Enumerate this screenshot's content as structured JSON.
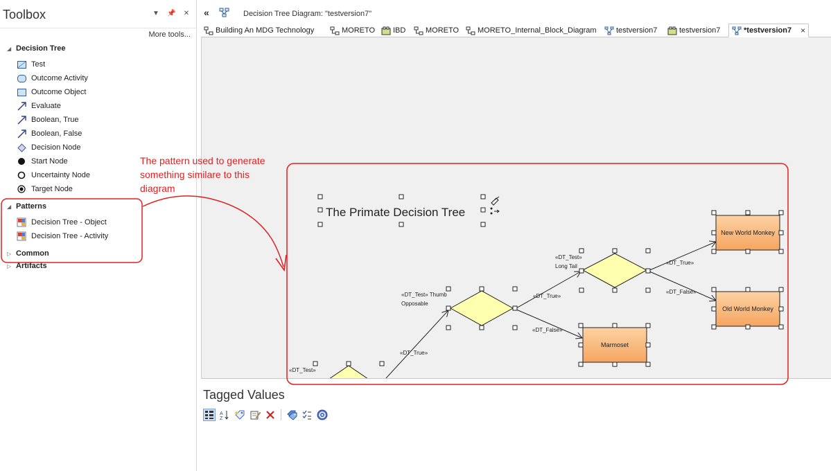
{
  "toolbox": {
    "title": "Toolbox",
    "more_tools": "More tools...",
    "groups": [
      {
        "label": "Decision Tree",
        "items": [
          {
            "label": "Test",
            "icon": "class-box-icon"
          },
          {
            "label": "Outcome Activity",
            "icon": "rounded-box-icon"
          },
          {
            "label": "Outcome Object",
            "icon": "class-box-icon"
          },
          {
            "label": "Evaluate",
            "icon": "arrow-icon"
          },
          {
            "label": "Boolean, True",
            "icon": "arrow-icon"
          },
          {
            "label": "Boolean, False",
            "icon": "arrow-icon"
          },
          {
            "label": "Decision Node",
            "icon": "diamond-icon"
          },
          {
            "label": "Start Node",
            "icon": "filled-circle-icon"
          },
          {
            "label": "Uncertainty Node",
            "icon": "hollow-circle-icon"
          },
          {
            "label": "Target Node",
            "icon": "target-circle-icon"
          }
        ]
      },
      {
        "label": "Patterns",
        "items": [
          {
            "label": "Decision Tree - Object",
            "icon": "pattern-icon"
          },
          {
            "label": "Decision Tree - Activity",
            "icon": "pattern-icon"
          }
        ]
      },
      {
        "label": "Common",
        "items": []
      },
      {
        "label": "Artifacts",
        "items": []
      }
    ]
  },
  "diagram_window": {
    "title": "Decision Tree Diagram: \"testversion7\"",
    "tabs": [
      {
        "label": "Building An MDG Technology",
        "icon": "diagram-icon"
      },
      {
        "label": "MORETO",
        "icon": "diagram-icon"
      },
      {
        "label": "IBD",
        "icon": "ibd-icon"
      },
      {
        "label": "MORETO",
        "icon": "diagram-icon"
      },
      {
        "label": "MORETO_Internal_Block_Diagram",
        "icon": "diagram-icon"
      },
      {
        "label": "testversion7",
        "icon": "decision-tree-icon"
      },
      {
        "label": "testversion7",
        "icon": "ibd-icon"
      },
      {
        "label": "*testversion7",
        "icon": "decision-tree-icon",
        "active": true
      }
    ],
    "close_tab": "×"
  },
  "diagram": {
    "heading": "The Primate Decision Tree",
    "labels": {
      "thumb_test": "«DT_Test» Thumb",
      "thumb_test_2": "Opposable",
      "tail_test": "«DT_Test»",
      "tail_test_2": "Long Tail",
      "partial_test": "«DT_Test»",
      "dt_true": "«DT_True»",
      "dt_false": "«DT_False»"
    },
    "outcomes": {
      "new_world": "New World Monkey",
      "old_world": "Old World Monkey",
      "marmoset": "Marmoset"
    },
    "colors": {
      "decision_fill": "#ffffb0",
      "outcome_fill_top": "#fdd2a4",
      "outcome_fill_bottom": "#f5a560",
      "annotation": "#e02020"
    }
  },
  "tagged_values": {
    "title": "Tagged Values"
  },
  "annotation": {
    "text": "The pattern used to generate something similare to this diagram"
  }
}
